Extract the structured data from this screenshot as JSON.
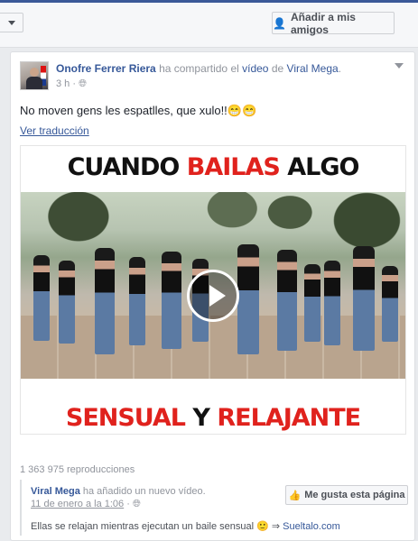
{
  "topbar": {
    "add_friend_label": "Añadir a mis amigos"
  },
  "post": {
    "author": "Onofre Ferrer Riera",
    "shared_text": "ha compartido el",
    "video_word": "vídeo",
    "of_text": "de",
    "page_name": "Viral Mega",
    "time": "3 h",
    "caption": "No moven gens les espatlles, que xulo!!",
    "caption_emoji": "😁😁",
    "translate_label": "Ver traducción"
  },
  "video": {
    "title_line1_a": "CUANDO ",
    "title_line1_b": "BAILAS",
    "title_line1_c": " ALGO",
    "title_line2_a": "SENSUAL",
    "title_line2_b": " Y ",
    "title_line2_c": "RELAJANTE"
  },
  "stats": {
    "views": "1 363 975 reproducciones"
  },
  "shared_from": {
    "page": "Viral Mega",
    "action": "ha añadido un nuevo vídeo.",
    "date": "11 de enero a la 1:06",
    "like_button": "Me gusta esta página",
    "description": "Ellas se relajan mientras ejecutan un baile sensual",
    "emoji": "🙂",
    "arrow": "⇒",
    "link": "Sueltalo.com"
  },
  "colors": {
    "link": "#365899",
    "accent_red": "#e0221d"
  }
}
